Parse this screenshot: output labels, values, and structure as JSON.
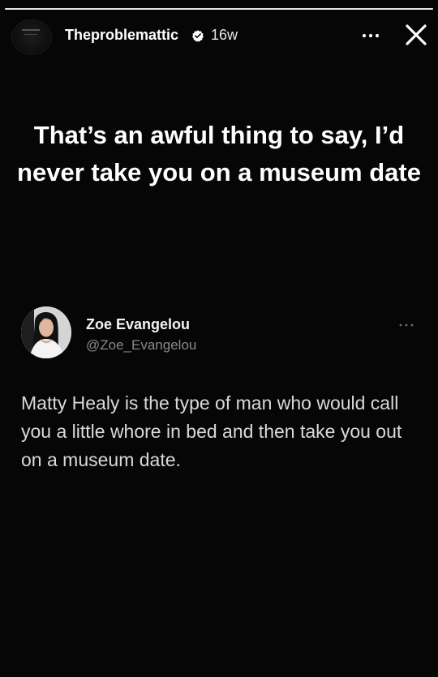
{
  "story": {
    "username": "Theproblemattic",
    "time": "16w",
    "progress": 1.0,
    "icons": {
      "avatar": "account-avatar-icon",
      "verified": "verified-badge-icon",
      "more": "more-options-icon",
      "close": "close-icon"
    }
  },
  "headline": "That’s an awful thing to say, I’d never take you on a museum date",
  "tweet": {
    "name": "Zoe Evangelou",
    "handle": "@Zoe_Evangelou",
    "text": "Matty Healy is the type of man who would call you a little whore in bed and then take you out on a museum date.",
    "icons": {
      "avatar": "profile-photo-icon",
      "more": "tweet-more-icon"
    }
  },
  "colors": {
    "background": "#060606",
    "text": "#ffffff",
    "muted": "#8a8a8a"
  }
}
